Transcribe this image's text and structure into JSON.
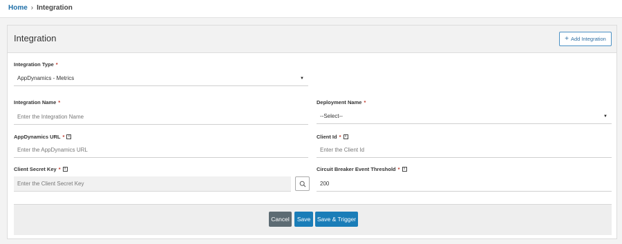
{
  "breadcrumb": {
    "home": "Home",
    "separator": "›",
    "current": "Integration"
  },
  "card": {
    "title": "Integration",
    "add_button": {
      "icon": "+",
      "label": "Add Integration"
    }
  },
  "form": {
    "required_mark": "*",
    "info_icon": "i",
    "integration_type": {
      "label": "Integration Type",
      "value": "AppDynamics - Metrics"
    },
    "integration_name": {
      "label": "Integration Name",
      "placeholder": "Enter the Integration Name"
    },
    "deployment_name": {
      "label": "Deployment Name",
      "value": "--Select--"
    },
    "appdynamics_url": {
      "label": "AppDynamics URL",
      "placeholder": "Enter the AppDynamics URL"
    },
    "client_id": {
      "label": "Client Id",
      "placeholder": "Enter the Client Id"
    },
    "client_secret_key": {
      "label": "Client Secret Key",
      "placeholder": "Enter the Client Secret Key"
    },
    "circuit_breaker": {
      "label": "Circuit Breaker Event Threshold",
      "value": "200"
    }
  },
  "footer": {
    "cancel": "Cancel",
    "save": "Save",
    "save_trigger": "Save & Trigger"
  },
  "colors": {
    "primary": "#1a7db8",
    "cancel": "#5d6b73",
    "link": "#1f6fa8",
    "required": "#c0392b"
  },
  "icons": {
    "add": "plus-icon",
    "dropdown": "caret-down-icon",
    "search": "search-icon",
    "info": "info-icon"
  }
}
